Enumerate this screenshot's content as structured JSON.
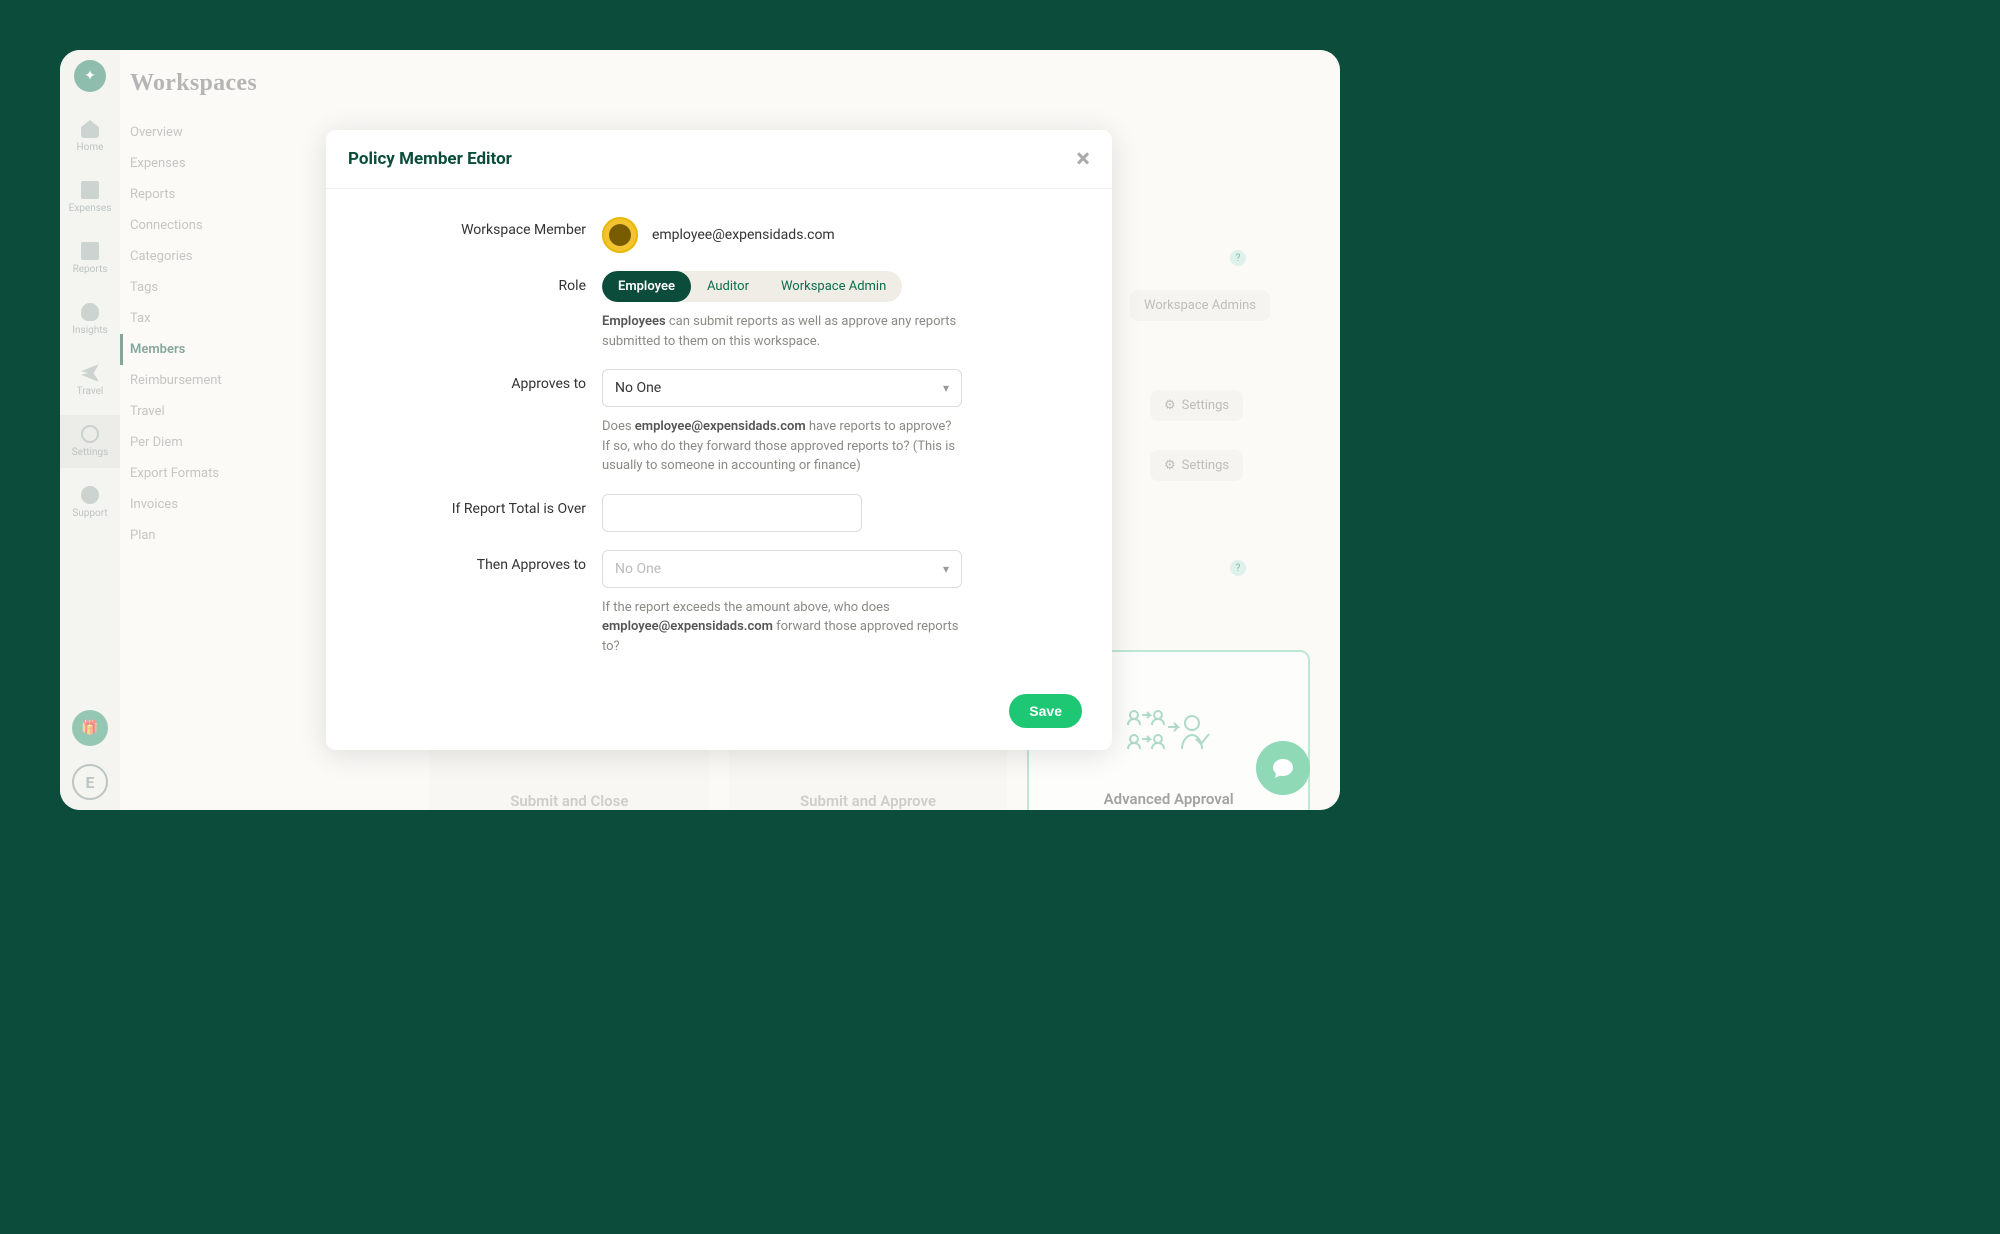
{
  "breadcrumb": "Workspaces",
  "rail": [
    {
      "label": "Home"
    },
    {
      "label": "Expenses"
    },
    {
      "label": "Reports"
    },
    {
      "label": "Insights"
    },
    {
      "label": "Travel"
    },
    {
      "label": "Settings"
    },
    {
      "label": "Support"
    }
  ],
  "sidebar": {
    "items": [
      {
        "label": "Overview"
      },
      {
        "label": "Expenses"
      },
      {
        "label": "Reports"
      },
      {
        "label": "Connections"
      },
      {
        "label": "Categories"
      },
      {
        "label": "Tags"
      },
      {
        "label": "Tax"
      },
      {
        "label": "Members"
      },
      {
        "label": "Reimbursement"
      },
      {
        "label": "Travel"
      },
      {
        "label": "Per Diem"
      },
      {
        "label": "Export Formats"
      },
      {
        "label": "Invoices"
      },
      {
        "label": "Plan"
      }
    ],
    "active_index": 7
  },
  "bg": {
    "workspace_admins": "Workspace Admins",
    "settings": "Settings",
    "help": "?"
  },
  "cards": [
    {
      "label": "Submit and Close"
    },
    {
      "label": "Submit and Approve"
    },
    {
      "label": "Advanced Approval"
    }
  ],
  "modal": {
    "title": "Policy Member Editor",
    "member_label": "Workspace Member",
    "member_email": "employee@expensidads.com",
    "role_label": "Role",
    "roles": [
      "Employee",
      "Auditor",
      "Workspace Admin"
    ],
    "role_active": 0,
    "role_help_bold": "Employees",
    "role_help_rest": " can submit reports as well as approve any reports submitted to them on this workspace.",
    "approves_label": "Approves to",
    "approves_value": "No One",
    "approves_help_pre": "Does ",
    "approves_help_bold": "employee@expensidads.com",
    "approves_help_post": " have reports to approve? If so, who do they forward those approved reports to? (This is usually to someone in accounting or finance)",
    "threshold_label": "If Report Total is Over",
    "threshold_value": "",
    "then_label": "Then Approves to",
    "then_value": "No One",
    "then_help_pre": "If the report exceeds the amount above, who does ",
    "then_help_bold": "employee@expensidads.com",
    "then_help_post": " forward those approved reports to?",
    "save": "Save"
  }
}
